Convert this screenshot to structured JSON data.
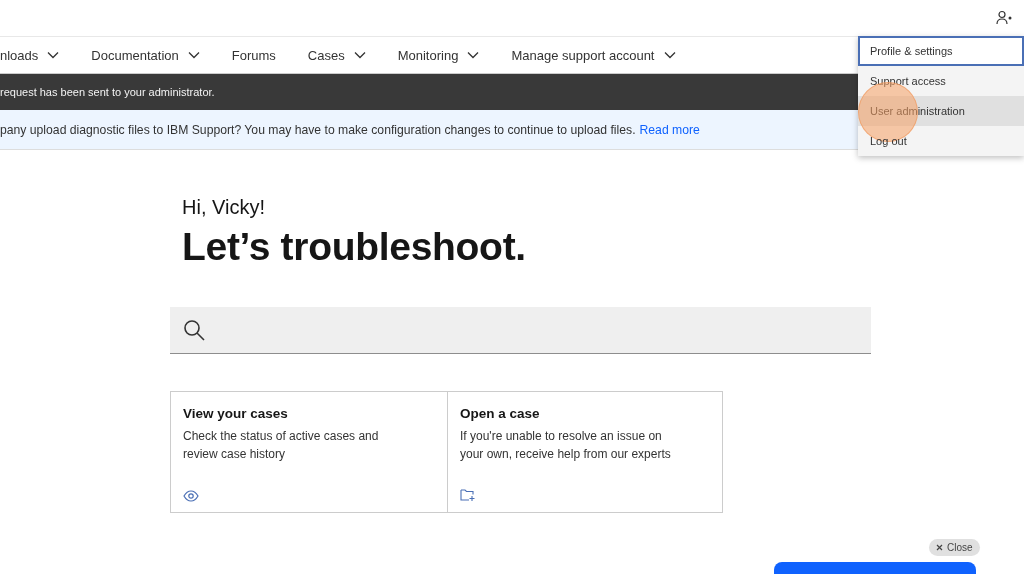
{
  "nav": {
    "items": [
      {
        "label": "nloads",
        "has_menu": true
      },
      {
        "label": "Documentation",
        "has_menu": true
      },
      {
        "label": "Forums",
        "has_menu": false
      },
      {
        "label": "Cases",
        "has_menu": true
      },
      {
        "label": "Monitoring",
        "has_menu": true
      },
      {
        "label": "Manage support account",
        "has_menu": true
      }
    ]
  },
  "notification": {
    "text": "request has been sent to your administrator."
  },
  "banner": {
    "text": "pany upload diagnostic files to IBM Support? You may have to make configuration changes to continue to upload files.",
    "link": "Read more"
  },
  "user_menu": {
    "items": [
      {
        "label": "Profile & settings",
        "focused": true,
        "hovered": false
      },
      {
        "label": "Support access",
        "focused": false,
        "hovered": false
      },
      {
        "label": "User administration",
        "focused": false,
        "hovered": true
      },
      {
        "label": "Log out",
        "focused": false,
        "hovered": false
      }
    ]
  },
  "greeting": "Hi, Vicky!",
  "heading": "Let’s troubleshoot.",
  "cards": [
    {
      "kind": "view",
      "title": "View your cases",
      "text": "Check the status of active cases and review case history"
    },
    {
      "kind": "open",
      "title": "Open a case",
      "text": "If you're unable to resolve an issue on your own, receive help from our experts"
    }
  ],
  "close_button": {
    "label": "Close"
  }
}
